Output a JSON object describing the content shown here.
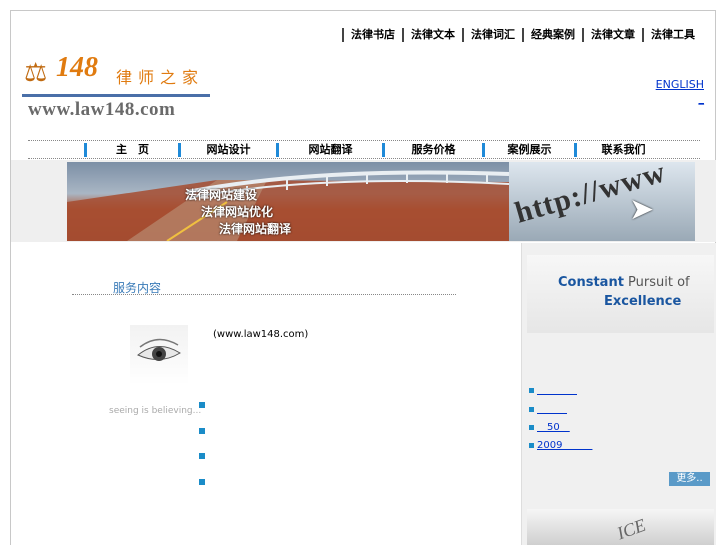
{
  "toplinks": [
    "法律书店",
    "法律文本",
    "法律词汇",
    "经典案例",
    "法律文章",
    "法律工具"
  ],
  "logo": {
    "number": "148",
    "name": "律师之家",
    "url": "www.law148.com"
  },
  "english": "ENGLISH",
  "english_dash": "_",
  "nav": [
    "主　页",
    "网站设计",
    "网站翻译",
    "服务价格",
    "案例展示",
    "联系我们"
  ],
  "banner": {
    "lines": [
      "法律网站建设",
      "法律网站优化",
      "法律网站翻译"
    ],
    "http": "http://www"
  },
  "service": {
    "title": "服务内容",
    "site": "(www.law148.com)",
    "tagline": "seeing is believing..."
  },
  "right": {
    "slogan1a": "Constant",
    "slogan1b": " Pursuit of",
    "slogan2": "Excellence",
    "items": [
      "　　　　",
      "　　　",
      "　50　",
      "2009　　　"
    ],
    "more": "更多..",
    "doc_text": "ICE"
  }
}
